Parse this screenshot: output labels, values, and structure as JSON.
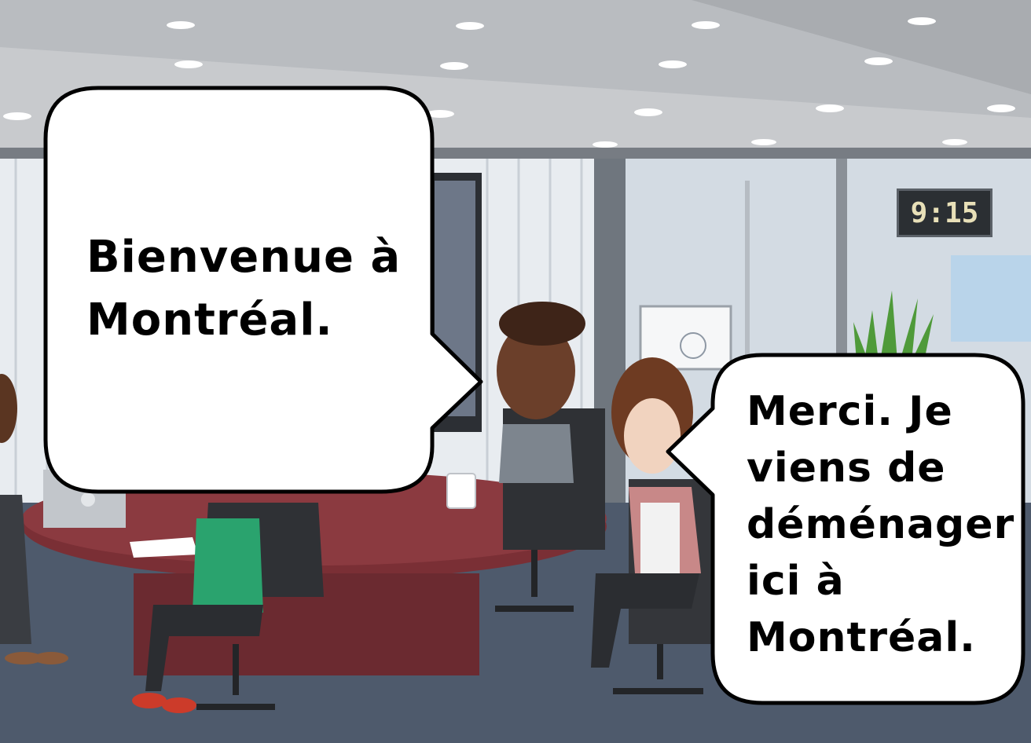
{
  "scene": {
    "clock": {
      "time": "9:15"
    },
    "speech_bubbles": [
      {
        "lines": [
          "Bienvenue à",
          "Montréal."
        ]
      },
      {
        "lines": [
          "Merci. Je",
          "viens de",
          "déménager",
          "ici à",
          "Montréal."
        ]
      }
    ],
    "colors": {
      "ceiling": "#b9bcc0",
      "wall": "#d9dde2",
      "floor": "#4e5a6c",
      "table": "#7a2f35",
      "bubble_fill": "#ffffff",
      "bubble_stroke": "#000000"
    }
  }
}
